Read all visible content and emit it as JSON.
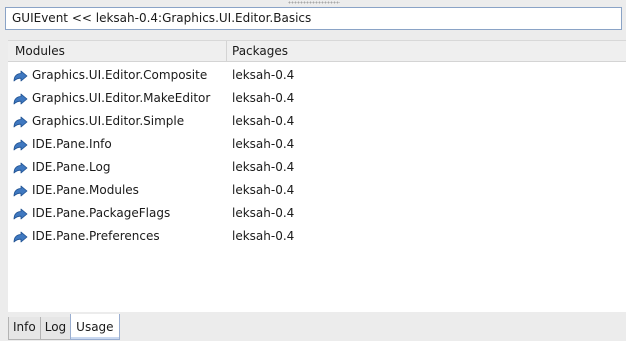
{
  "title_bar": {
    "text": "GUIEvent << leksah-0.4:Graphics.UI.Editor.Basics"
  },
  "table": {
    "headers": {
      "modules": "Modules",
      "packages": "Packages"
    },
    "rows": [
      {
        "module": "Graphics.UI.Editor.Composite",
        "package": "leksah-0.4",
        "icon": "module-arrow-icon"
      },
      {
        "module": "Graphics.UI.Editor.MakeEditor",
        "package": "leksah-0.4",
        "icon": "module-arrow-icon"
      },
      {
        "module": "Graphics.UI.Editor.Simple",
        "package": "leksah-0.4",
        "icon": "module-arrow-icon"
      },
      {
        "module": "IDE.Pane.Info",
        "package": "leksah-0.4",
        "icon": "module-arrow-icon"
      },
      {
        "module": "IDE.Pane.Log",
        "package": "leksah-0.4",
        "icon": "module-arrow-icon"
      },
      {
        "module": "IDE.Pane.Modules",
        "package": "leksah-0.4",
        "icon": "module-arrow-icon"
      },
      {
        "module": "IDE.Pane.PackageFlags",
        "package": "leksah-0.4",
        "icon": "module-arrow-icon"
      },
      {
        "module": "IDE.Pane.Preferences",
        "package": "leksah-0.4",
        "icon": "module-arrow-icon"
      }
    ]
  },
  "tabs": [
    {
      "label": "Info",
      "active": false
    },
    {
      "label": "Log",
      "active": false
    },
    {
      "label": "Usage",
      "active": true
    }
  ],
  "colors": {
    "icon_fill": "#3f78c0",
    "icon_edge": "#1d4f8f",
    "active_tab_border": "#9aaed0"
  }
}
